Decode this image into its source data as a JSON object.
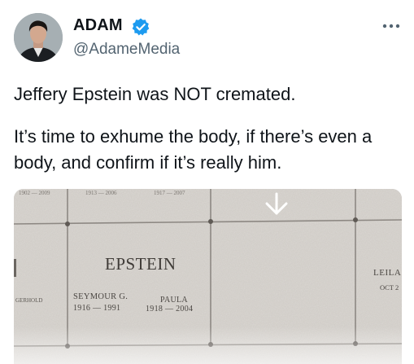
{
  "author": {
    "display_name": "ADAM",
    "handle": "@AdameMedia",
    "verified_color": "#1d9bf0"
  },
  "post": {
    "paragraph_1": "Jeffery Epstein was NOT cremated.",
    "paragraph_2": "It’s time to exhume the body, if there’s even a body, and confirm if it’s really him."
  },
  "photo": {
    "surname": "EPSTEIN",
    "person_1": {
      "name": "SEYMOUR G.",
      "years": "1916 — 1991"
    },
    "person_2": {
      "name": "PAULA",
      "years": "1918 — 2004"
    },
    "left_neighbor": "GERHOLD",
    "right_neighbor": {
      "name": "LEILA",
      "date": "OCT 2"
    },
    "top_years": [
      "1902 — 2009",
      "1913 — 2006",
      "1917 — 2007"
    ]
  },
  "icons": {
    "more": "more-horizontal-icon",
    "verified": "verified-badge-icon",
    "arrow": "down-arrow-icon"
  }
}
